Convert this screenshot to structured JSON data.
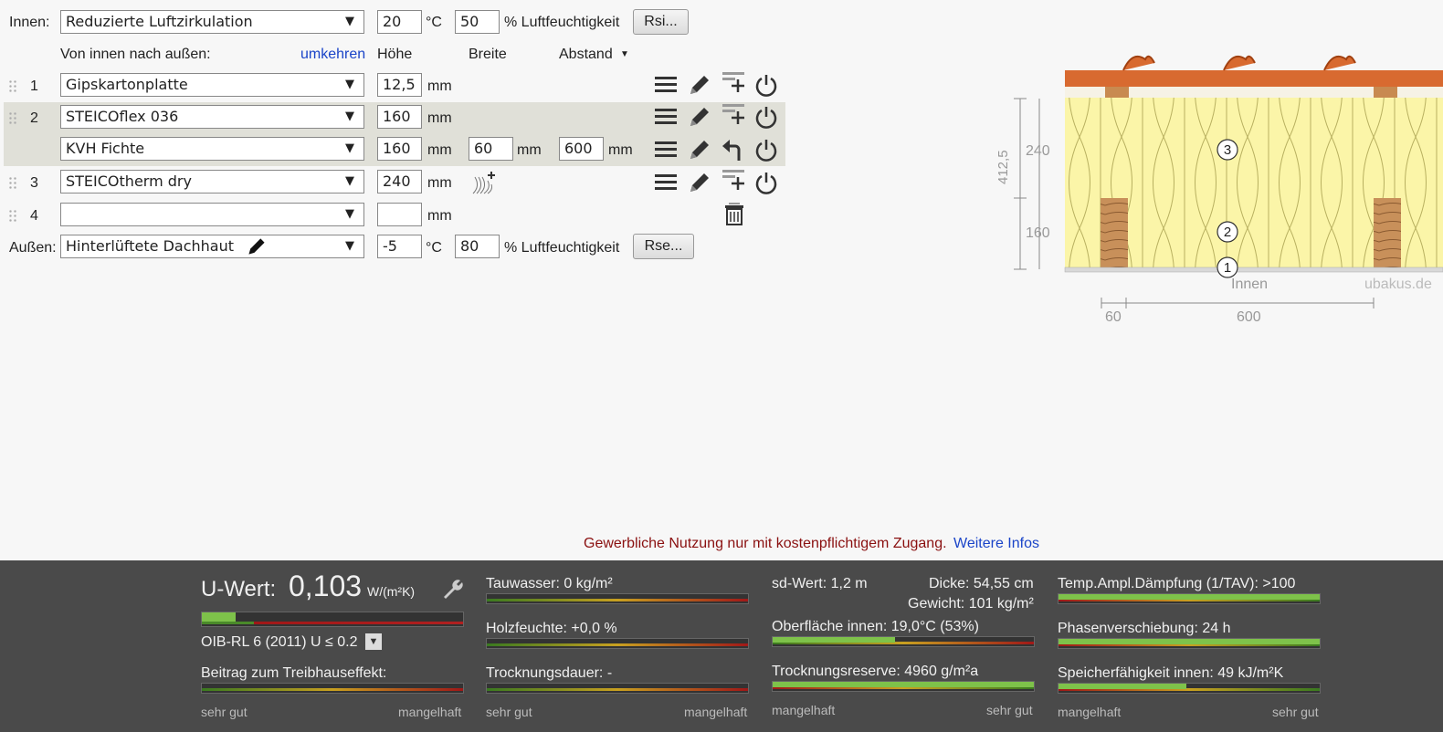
{
  "inside": {
    "label": "Innen:",
    "select": "Reduzierte Luftzirkulation",
    "temp": "20",
    "temp_unit": "°C",
    "humidity": "50",
    "humidity_label": "% Luftfeuchtigkeit",
    "rsi_button": "Rsi..."
  },
  "headers": {
    "direction": "Von innen nach außen:",
    "reverse": "umkehren",
    "height": "Höhe",
    "width": "Breite",
    "spacing": "Abstand"
  },
  "layers": [
    {
      "num": "1",
      "material": "Gipskartonplatte",
      "thickness": "12,5",
      "unit": "mm"
    },
    {
      "num": "2",
      "material": "STEICOflex 036",
      "thickness": "160",
      "unit": "mm"
    },
    {
      "num": "",
      "material": "KVH Fichte",
      "thickness": "160",
      "unit": "mm",
      "width": "60",
      "width_unit": "mm",
      "spacing": "600",
      "spacing_unit": "mm"
    },
    {
      "num": "3",
      "material": "STEICOtherm dry",
      "thickness": "240",
      "unit": "mm"
    },
    {
      "num": "4",
      "material": "",
      "thickness": "",
      "unit": "mm"
    }
  ],
  "outside": {
    "label": "Außen:",
    "select": "Hinterlüftete Dachhaut",
    "temp": "-5",
    "temp_unit": "°C",
    "humidity": "80",
    "humidity_label": "% Luftfeuchtigkeit",
    "rse_button": "Rse..."
  },
  "diagram": {
    "total": "412,5",
    "dim_top": "240",
    "dim_bottom": "160",
    "marker1": "1",
    "marker2": "2",
    "marker3": "3",
    "inside_label": "Innen",
    "watermark": "ubakus.de",
    "dim_width": "60",
    "dim_spacing": "600"
  },
  "notice": {
    "text": "Gewerbliche Nutzung nur mit kostenpflichtigem Zugang.",
    "link": "Weitere Infos"
  },
  "results": {
    "uwert_label": "U-Wert:",
    "uwert_value": "0,103",
    "uwert_unit": "W/(m²K)",
    "uwert_level": 0.13,
    "oib": "OIB-RL 6 (2011) U ≤ 0.2",
    "greenhouse": "Beitrag zum Treibhauseffekt:",
    "tauwasser": "Tauwasser: 0 kg/m²",
    "holzfeuchte": "Holzfeuchte: +0,0 %",
    "trocknungsdauer": "Trocknungsdauer: -",
    "sd": "sd-Wert: 1,2 m",
    "dicke": "Dicke: 54,55 cm",
    "gewicht": "Gewicht: 101 kg/m²",
    "oberflaeche": "Oberfläche innen: 19,0°C (53%)",
    "oberflaeche_level": 0.47,
    "reserve": "Trocknungsreserve: 4960 g/m²a",
    "reserve_level": 1.0,
    "tav": "Temp.Ampl.Dämpfung (1/TAV): >100",
    "tav_level": 1.0,
    "phase": "Phasenverschiebung: 24 h",
    "phase_level": 1.0,
    "speicher": "Speicherfähigkeit innen: 49 kJ/m²K",
    "speicher_level": 0.49,
    "scale_good": "sehr gut",
    "scale_bad": "mangelhaft"
  }
}
